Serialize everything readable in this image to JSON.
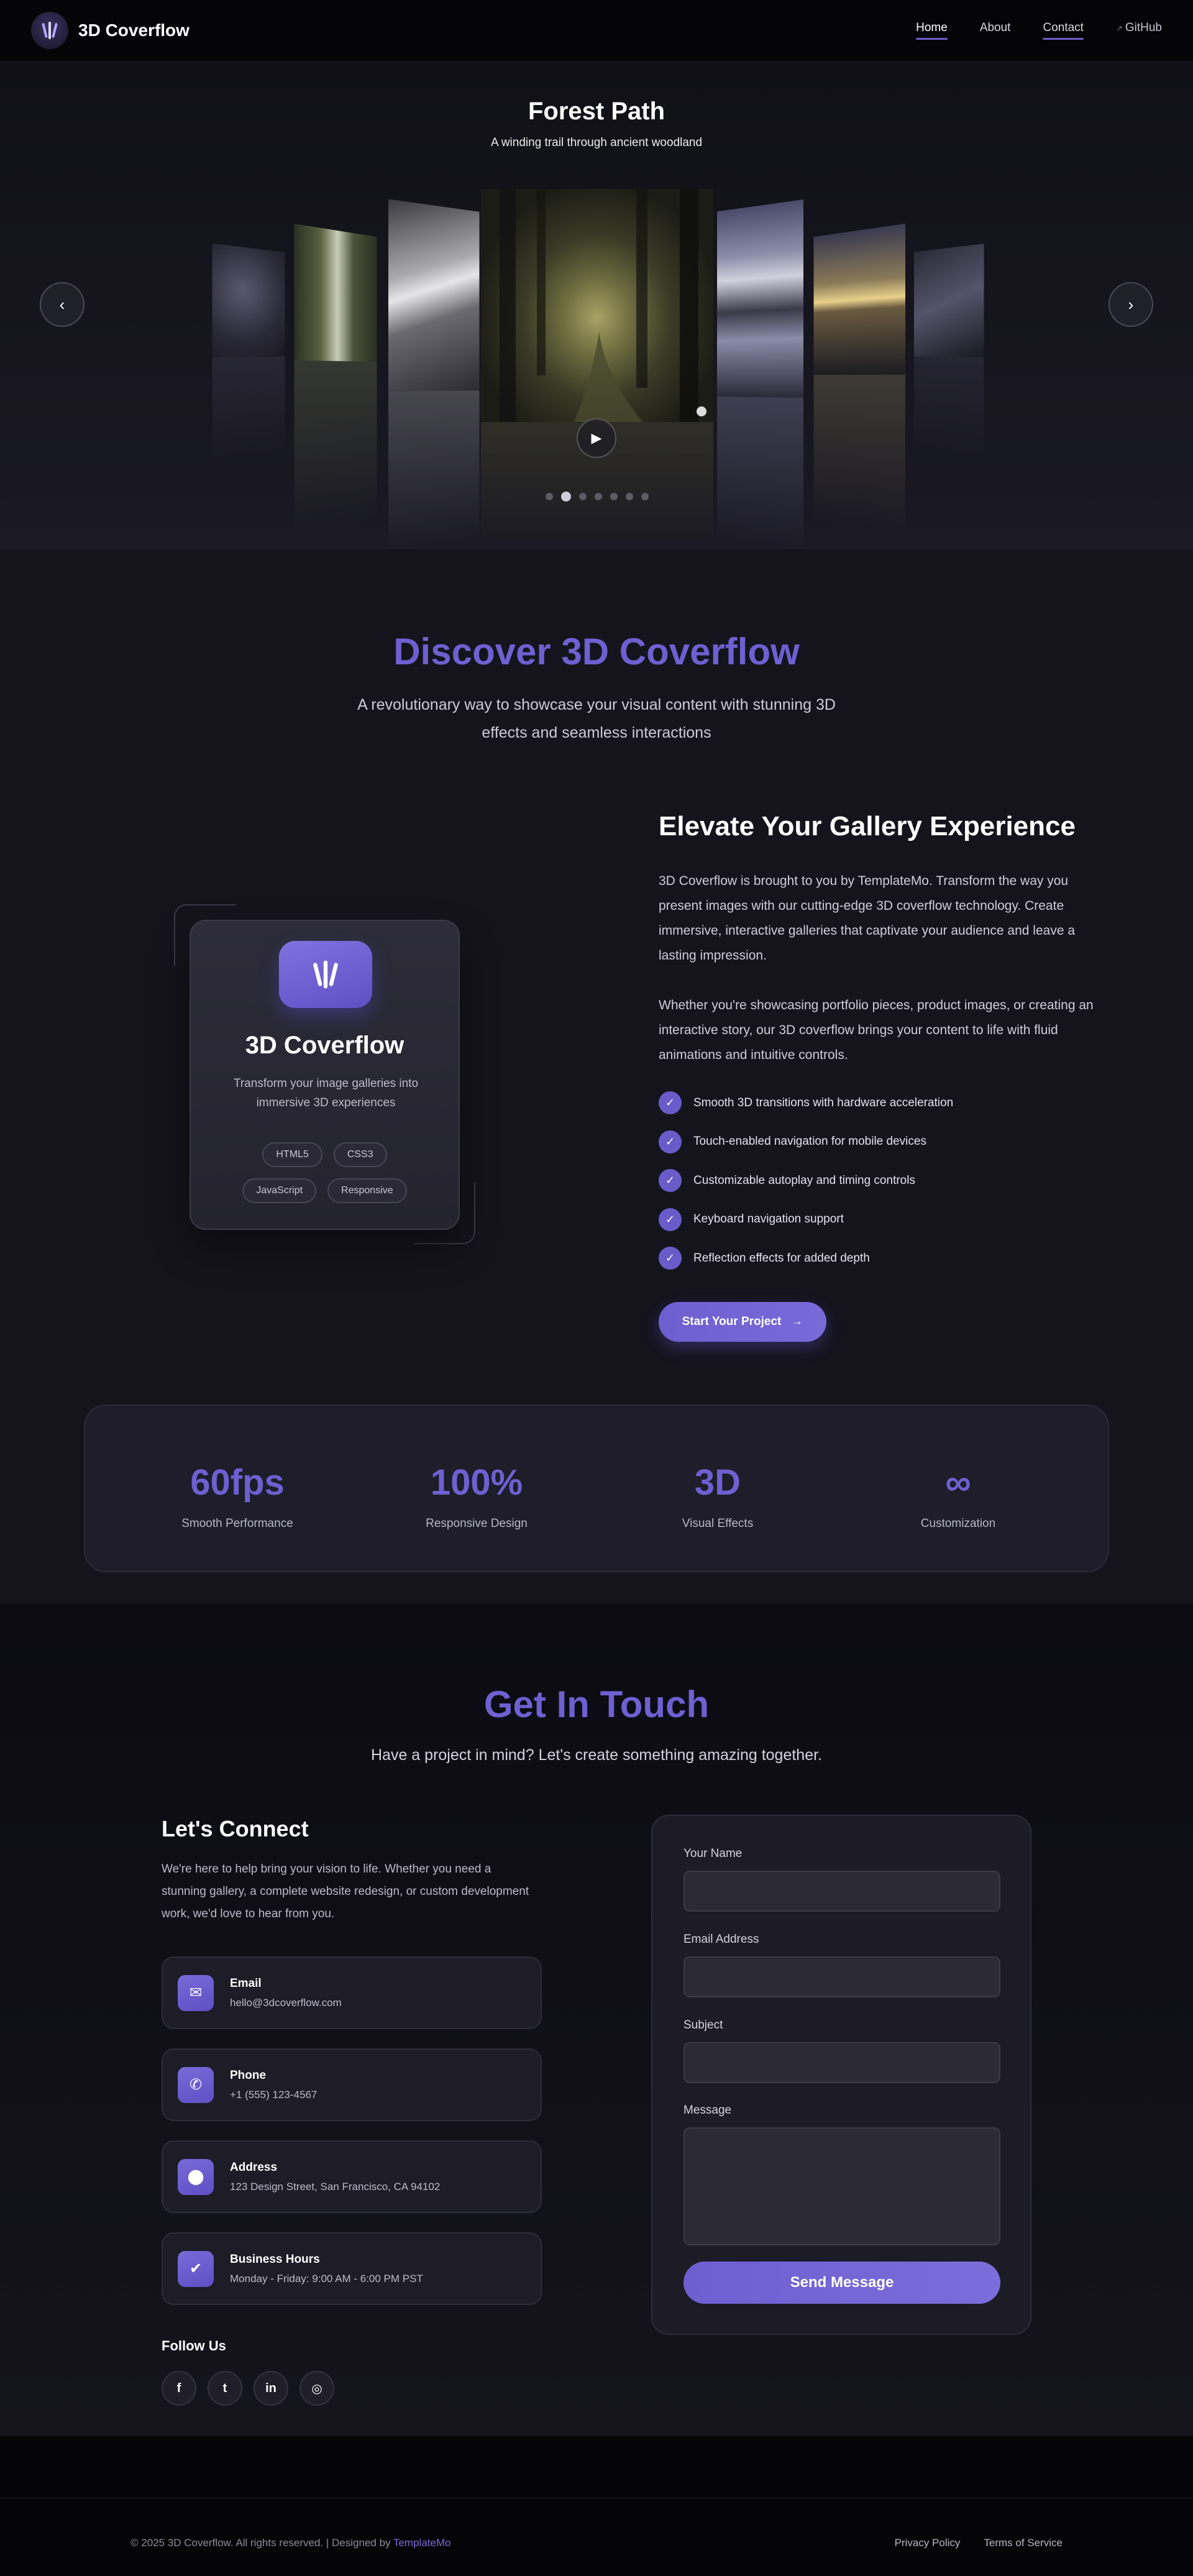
{
  "header": {
    "brand": "3D Coverflow",
    "nav": [
      {
        "label": "Home"
      },
      {
        "label": "About"
      },
      {
        "label": "Contact"
      },
      {
        "label": "GitHub"
      }
    ]
  },
  "hero": {
    "title": "Forest Path",
    "subtitle": "A winding trail through ancient woodland",
    "prev_icon": "chevron-left-icon",
    "next_icon": "chevron-right-icon",
    "play_icon": "play-icon",
    "slide_count": 7,
    "active_dot": 1
  },
  "discover": {
    "title": "Discover 3D Coverflow",
    "subtitle": "A revolutionary way to showcase your visual content with stunning 3D effects and seamless interactions"
  },
  "card": {
    "title": "3D Coverflow",
    "description": "Transform your image galleries into immersive 3D experiences",
    "tags": [
      "HTML5",
      "CSS3",
      "JavaScript",
      "Responsive"
    ]
  },
  "elevate": {
    "title": "Elevate Your Gallery Experience",
    "p1": "3D Coverflow is brought to you by TemplateMo. Transform the way you present images with our cutting-edge 3D coverflow technology. Create immersive, interactive galleries that captivate your audience and leave a lasting impression.",
    "p2": "Whether you're showcasing portfolio pieces, product images, or creating an interactive story, our 3D coverflow brings your content to life with fluid animations and intuitive controls.",
    "features": [
      "Smooth 3D transitions with hardware acceleration",
      "Touch-enabled navigation for mobile devices",
      "Customizable autoplay and timing controls",
      "Keyboard navigation support",
      "Reflection effects for added depth"
    ],
    "cta": "Start Your Project"
  },
  "stats": [
    {
      "value": "60fps",
      "label": "Smooth Performance"
    },
    {
      "value": "100%",
      "label": "Responsive Design"
    },
    {
      "value": "3D",
      "label": "Visual Effects"
    },
    {
      "value": "∞",
      "label": "Customization"
    }
  ],
  "contact": {
    "title": "Get In Touch",
    "subtitle": "Have a project in mind? Let's create something amazing together.",
    "connect_title": "Let's Connect",
    "connect_text": "We're here to help bring your vision to life. Whether you need a stunning gallery, a complete website redesign, or custom development work, we'd love to hear from you.",
    "info": [
      {
        "label": "Email",
        "value": "hello@3dcoverflow.com",
        "icon": "mail-icon"
      },
      {
        "label": "Phone",
        "value": "+1 (555) 123-4567",
        "icon": "phone-icon"
      },
      {
        "label": "Address",
        "value": "123 Design Street, San Francisco, CA 94102",
        "icon": "location-pin-icon"
      },
      {
        "label": "Business Hours",
        "value": "Monday - Friday: 9:00 AM - 6:00 PM PST",
        "icon": "clock-check-icon"
      }
    ],
    "follow_title": "Follow Us",
    "socials": [
      "facebook-icon",
      "twitter-icon",
      "linkedin-icon",
      "instagram-icon"
    ],
    "form": {
      "name_label": "Your Name",
      "email_label": "Email Address",
      "subject_label": "Subject",
      "message_label": "Message",
      "name_value": "",
      "email_value": "",
      "subject_value": "",
      "message_value": "",
      "submit": "Send Message"
    }
  },
  "footer": {
    "copyright": "© 2025 3D Coverflow. All rights reserved. | Designed by",
    "designer": "TemplateMo",
    "links": [
      "Privacy Policy",
      "Terms of Service"
    ]
  },
  "colors": {
    "accent": "#6f5fd0",
    "background": "#15141d",
    "header": "#050507"
  }
}
